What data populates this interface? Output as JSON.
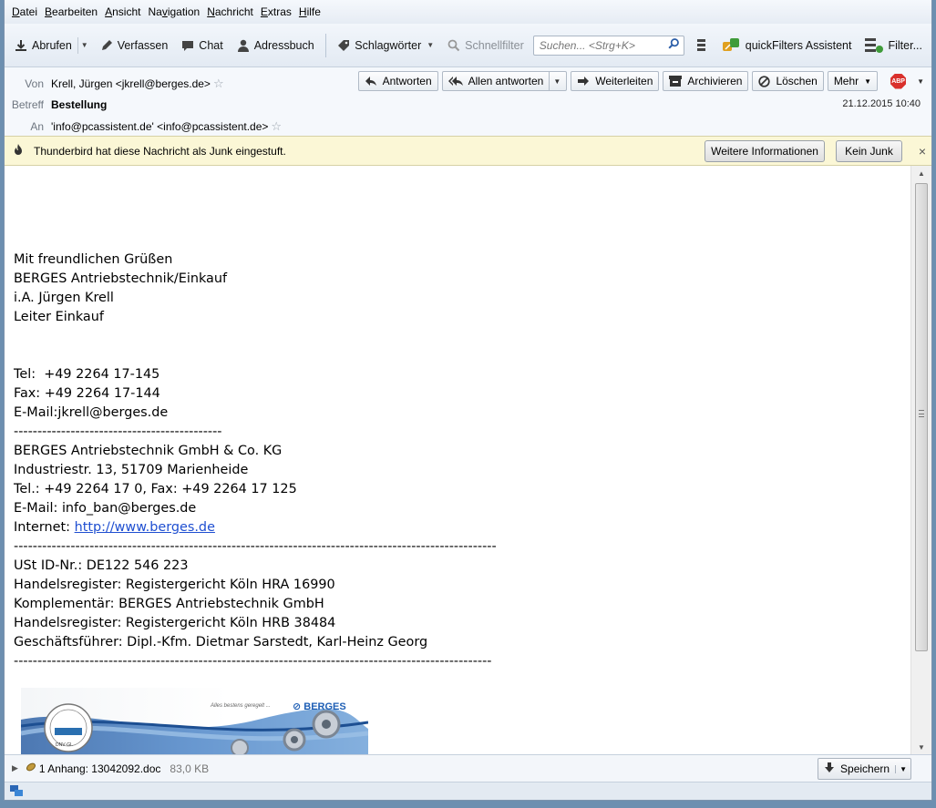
{
  "menubar": {
    "items": [
      {
        "pre": "",
        "ul": "D",
        "post": "atei"
      },
      {
        "pre": "",
        "ul": "B",
        "post": "earbeiten"
      },
      {
        "pre": "",
        "ul": "A",
        "post": "nsicht"
      },
      {
        "pre": "Na",
        "ul": "v",
        "post": "igation"
      },
      {
        "pre": "",
        "ul": "N",
        "post": "achricht"
      },
      {
        "pre": "",
        "ul": "E",
        "post": "xtras"
      },
      {
        "pre": "",
        "ul": "H",
        "post": "ilfe"
      }
    ]
  },
  "toolbar": {
    "get_mail": "Abrufen",
    "compose": "Verfassen",
    "chat": "Chat",
    "address_book": "Adressbuch",
    "tags": "Schlagwörter",
    "quick_filter": "Schnellfilter",
    "search_placeholder": "Suchen... <Strg+K>",
    "quickfilters_assistant": "quickFilters Assistent",
    "filter": "Filter..."
  },
  "header": {
    "from_label": "Von",
    "from_value": "Krell, Jürgen <jkrell@berges.de>",
    "subject_label": "Betreff",
    "subject_value": "Bestellung",
    "to_label": "An",
    "to_value": "'info@pcassistent.de' <info@pcassistent.de>",
    "date": "21.12.2015 10:40",
    "actions": {
      "reply": "Antworten",
      "reply_all": "Allen antworten",
      "forward": "Weiterleiten",
      "archive": "Archivieren",
      "delete": "Löschen",
      "more": "Mehr",
      "adblock": "ABP"
    }
  },
  "junkbar": {
    "message": "Thunderbird hat diese Nachricht als Junk eingestuft.",
    "more_info": "Weitere Informationen",
    "not_junk": "Kein Junk",
    "close": "×"
  },
  "body": {
    "lines_before_link": [
      "Mit freundlichen Grüßen",
      "BERGES Antriebstechnik/Einkauf",
      "i.A. Jürgen Krell",
      "Leiter Einkauf",
      "",
      "",
      "Tel:  +49 2264 17-145",
      "Fax: +49 2264 17-144",
      "E-Mail:jkrell@berges.de",
      "--------------------------------------------",
      "BERGES Antriebstechnik GmbH & Co. KG",
      "Industriestr. 13, 51709 Marienheide",
      "Tel.: +49 2264 17 0, Fax: +49 2264 17 125",
      "E-Mail: info_ban@berges.de"
    ],
    "internet_label": "Internet: ",
    "internet_link": "http://www.berges.de",
    "lines_after_link": [
      "------------------------------------------------------------------------------------------------------",
      "USt ID-Nr.: DE122 546 223",
      "Handelsregister: Registergericht Köln HRA 16990",
      "Komplementär: BERGES Antriebstechnik GmbH",
      "Handelsregister: Registergericht Köln HRB 38484",
      "Geschäftsführer: Dipl.-Kfm. Dietmar Sarstedt, Karl-Heinz Georg",
      "-----------------------------------------------------------------------------------------------------"
    ],
    "banner": {
      "tagline": "Alles bestens geregelt ...",
      "brand": "BERGES",
      "badge": "DNV·GL"
    }
  },
  "attachments": {
    "label": "1 Anhang: 13042092.doc",
    "size": "83,0 KB",
    "save": "Speichern"
  },
  "colors": {
    "junkbar_bg": "#fbf7d6",
    "link": "#1f4fd1",
    "brand_blue": "#1f5fb5"
  }
}
